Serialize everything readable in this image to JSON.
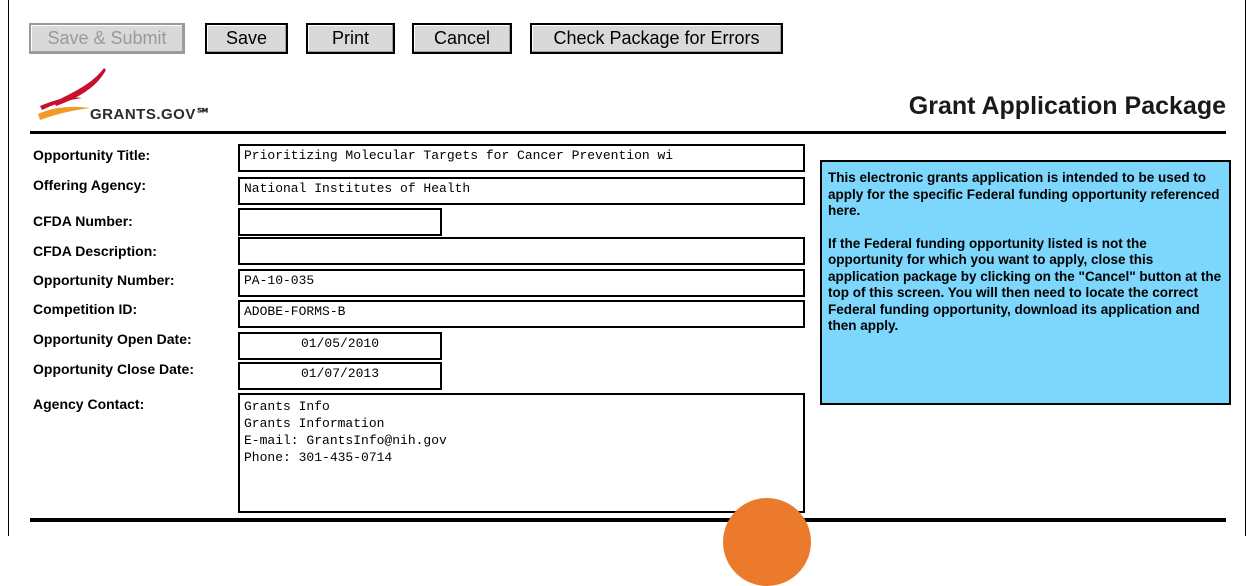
{
  "toolbar": {
    "save_submit": "Save & Submit",
    "save": "Save",
    "print": "Print",
    "cancel": "Cancel",
    "check": "Check Package for Errors"
  },
  "brand": {
    "logo_text": "GRANTS.GOV℠",
    "colors": {
      "swoosh_red": "#c8102e",
      "swoosh_orange": "#f29a26",
      "info_bg": "#7dd6fb",
      "watermark": "#ec7a2c"
    }
  },
  "header": {
    "title": "Grant Application Package"
  },
  "form": {
    "labels": {
      "opportunity_title": "Opportunity Title:",
      "offering_agency": "Offering Agency:",
      "cfda_number": "CFDA Number:",
      "cfda_description": "CFDA Description:",
      "opportunity_number": "Opportunity Number:",
      "competition_id": "Competition ID:",
      "open_date": "Opportunity Open Date:",
      "close_date": "Opportunity Close Date:",
      "agency_contact": "Agency Contact:"
    },
    "values": {
      "opportunity_title": "Prioritizing Molecular Targets for Cancer Prevention wi",
      "offering_agency": "National Institutes of Health",
      "cfda_number": "",
      "cfda_description": "",
      "opportunity_number": "PA-10-035",
      "competition_id": "ADOBE-FORMS-B",
      "open_date": "01/05/2010",
      "close_date": "01/07/2013",
      "agency_contact": "Grants Info\nGrants Information\nE-mail: GrantsInfo@nih.gov\nPhone: 301-435-0714"
    }
  },
  "info": {
    "para1": "This electronic grants application is intended to be used to apply for the specific Federal funding opportunity referenced here.",
    "para2": "If the Federal funding opportunity listed is not the opportunity for which you want to apply, close this application package by clicking on the \"Cancel\" button at the top of this screen. You will  then need to locate the correct Federal funding opportunity, download its application and then apply."
  }
}
